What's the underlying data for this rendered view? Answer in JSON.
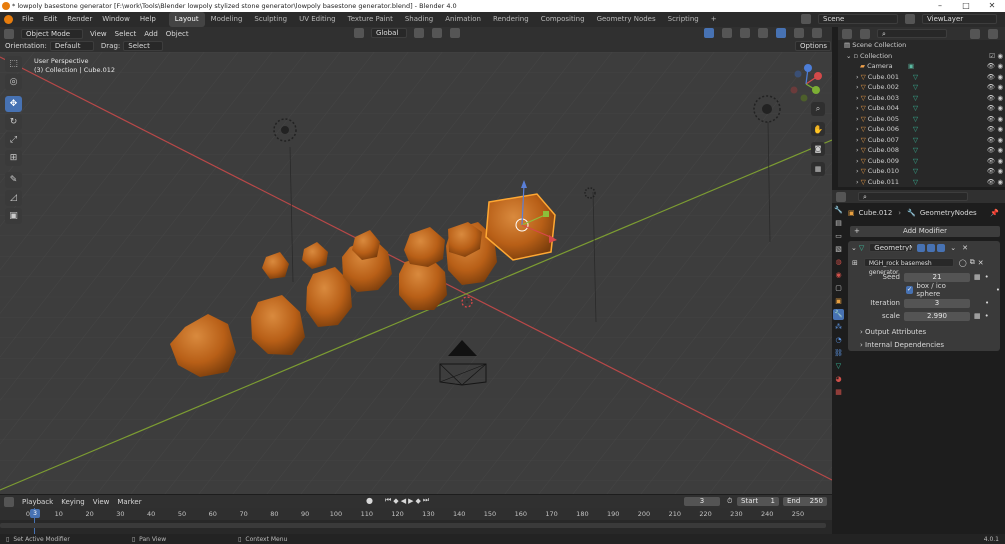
{
  "window": {
    "title": "* lowpoly basestone generator [F:\\work\\Tools\\Blender lowpoly stylized stone generator\\lowpoly basestone generator.blend] - Blender 4.0"
  },
  "menu": {
    "items": [
      "File",
      "Edit",
      "Render",
      "Window",
      "Help"
    ],
    "workspaces": [
      "Layout",
      "Modeling",
      "Sculpting",
      "UV Editing",
      "Texture Paint",
      "Shading",
      "Animation",
      "Rendering",
      "Compositing",
      "Geometry Nodes",
      "Scripting"
    ],
    "active_workspace": "Layout",
    "add_tab": "+",
    "scene": "Scene",
    "view_layer": "ViewLayer"
  },
  "viewport_header": {
    "mode": "Object Mode",
    "menus": [
      "View",
      "Select",
      "Add",
      "Object"
    ],
    "transform_orientation": "Global"
  },
  "viewport_subheader": {
    "orientation_label": "Orientation:",
    "orientation_value": "Default",
    "drag_label": "Drag:",
    "drag_value": "Select Box",
    "options": "Options"
  },
  "viewport": {
    "overlay_line1": "User Perspective",
    "overlay_line2": "(3) Collection | Cube.012",
    "gizmo_x": "X",
    "gizmo_y": "Y",
    "gizmo_z": "Z"
  },
  "outliner": {
    "root": "Scene Collection",
    "collection": "Collection",
    "items": [
      "Camera",
      "Cube.001",
      "Cube.002",
      "Cube.003",
      "Cube.004",
      "Cube.005",
      "Cube.006",
      "Cube.007",
      "Cube.008",
      "Cube.009",
      "Cube.010",
      "Cube.011"
    ]
  },
  "properties": {
    "object_name": "Cube.012",
    "modifier_breadcrumb": "GeometryNodes",
    "add_modifier": "Add Modifier",
    "modifier_name": "GeometryNo...",
    "node_group": "MGH_rock basemesh generator",
    "seed_label": "Seed",
    "seed_value": "21",
    "checkbox_label": "box / ico sphere",
    "iteration_label": "Iteration",
    "iteration_value": "3",
    "scale_label": "scale",
    "scale_value": "2.990",
    "output_attributes": "Output Attributes",
    "internal_dependencies": "Internal Dependencies"
  },
  "timeline": {
    "menus": [
      "Playback",
      "Keying",
      "View",
      "Marker"
    ],
    "current_frame": "3",
    "start_label": "Start",
    "start_value": "1",
    "end_label": "End",
    "end_value": "250",
    "ticks": [
      "0",
      "10",
      "20",
      "30",
      "40",
      "50",
      "60",
      "70",
      "80",
      "90",
      "100",
      "110",
      "120",
      "130",
      "140",
      "150",
      "160",
      "170",
      "180",
      "190",
      "200",
      "210",
      "220",
      "230",
      "240",
      "250"
    ],
    "playhead_label": "3"
  },
  "statusbar": {
    "left": "Set Active Modifier",
    "middle": "Pan View",
    "right": "Context Menu",
    "version": "4.0.1"
  },
  "colors": {
    "accent": "#4772b3",
    "rock": "#c8681a",
    "selection_outline": "#ffa833",
    "x_axis": "#c84a4a",
    "y_axis": "#86a63a"
  }
}
